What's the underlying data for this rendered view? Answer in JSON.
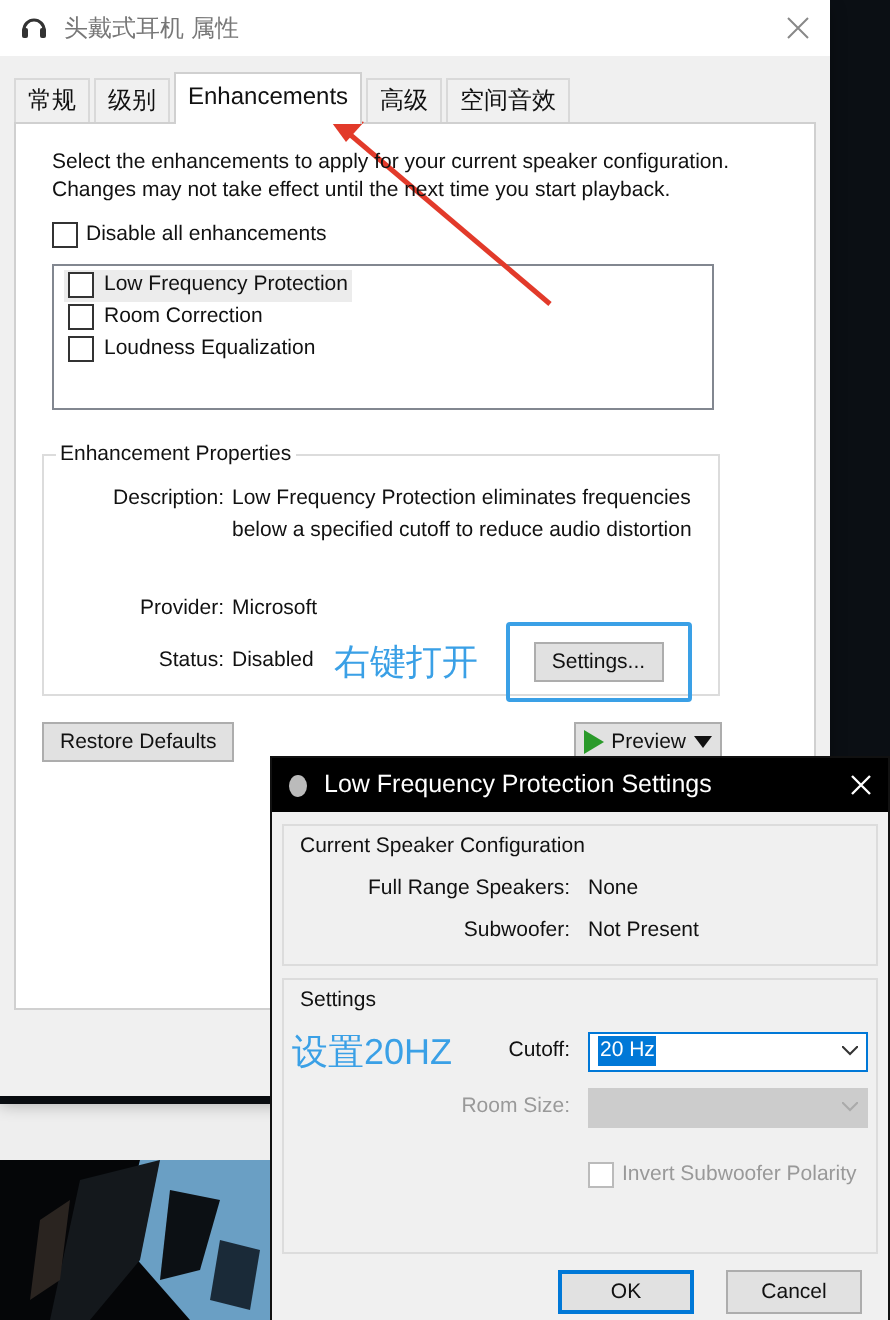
{
  "window": {
    "title": "头戴式耳机 属性"
  },
  "tabs": [
    {
      "label": "常规",
      "selected": false
    },
    {
      "label": "级别",
      "selected": false
    },
    {
      "label": "Enhancements",
      "selected": true
    },
    {
      "label": "高级",
      "selected": false
    },
    {
      "label": "空间音效",
      "selected": false
    }
  ],
  "intro": "Select the enhancements to apply for your current speaker configuration. Changes may not take effect until the next time you start playback.",
  "disable_all": {
    "label": "Disable all enhancements",
    "checked": false
  },
  "enhancements": [
    {
      "label": "Low Frequency Protection",
      "checked": false,
      "selected": true
    },
    {
      "label": "Room Correction",
      "checked": false,
      "selected": false
    },
    {
      "label": "Loudness Equalization",
      "checked": false,
      "selected": false
    }
  ],
  "properties": {
    "title": "Enhancement Properties",
    "description_label": "Description:",
    "description": "Low Frequency Protection eliminates frequencies below a specified cutoff to reduce audio distortion",
    "provider_label": "Provider:",
    "provider": "Microsoft",
    "status_label": "Status:",
    "status": "Disabled",
    "note": "右键打开",
    "settings_button": "Settings..."
  },
  "buttons": {
    "restore_defaults": "Restore Defaults",
    "preview": "Preview"
  },
  "dialog": {
    "title": "Low Frequency Protection Settings",
    "config": {
      "title": "Current Speaker Configuration",
      "rows": [
        {
          "label": "Full Range Speakers:",
          "value": "None"
        },
        {
          "label": "Subwoofer:",
          "value": "Not Present"
        }
      ]
    },
    "settings": {
      "title": "Settings",
      "note": "设置20HZ",
      "cutoff_label": "Cutoff:",
      "cutoff_value": "20 Hz",
      "room_size_label": "Room Size:",
      "room_size_disabled": true,
      "invert": {
        "label": "Invert Subwoofer Polarity",
        "checked": false,
        "disabled": true
      }
    },
    "ok": "OK",
    "cancel": "Cancel"
  }
}
